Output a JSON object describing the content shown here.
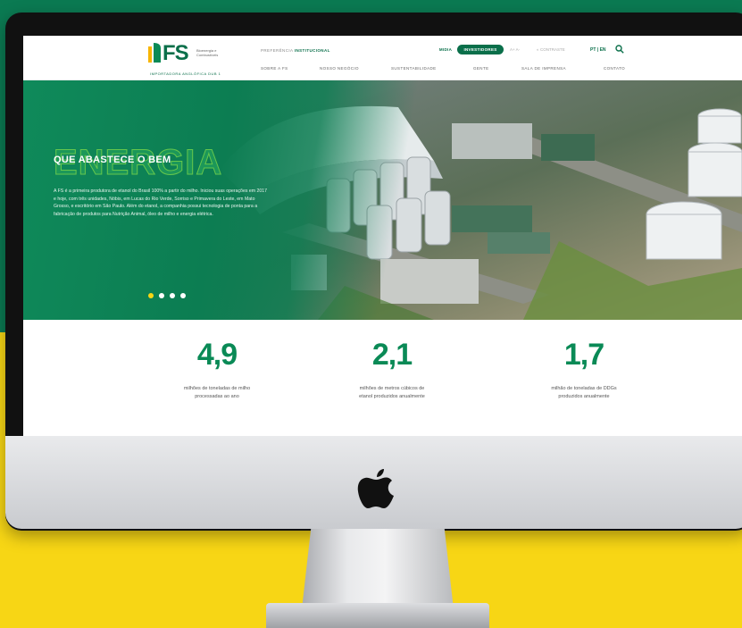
{
  "brand": {
    "logo_text": "FS",
    "logo_sub": "Bioenergia e Combustíveis",
    "logo_tag": "IMPORTADORA ANGLÓFICA DUB 1",
    "green": "#0a6f4a",
    "yellow": "#f7d615"
  },
  "topbar": {
    "left_text": "PREFERÊNCIA ",
    "left_bold": "INSTITUCIONAL",
    "midia_label": "MIDIA",
    "investidores_label": "INVESTIDORES",
    "font_controls": "A+  A-",
    "contrast_label": "◐ CONTRASTE",
    "lang_label": "PT | EN",
    "search_icon": "search-icon"
  },
  "nav": {
    "items": [
      {
        "label": "SOBRE A FS"
      },
      {
        "label": "NOSSO NEGÓCIO"
      },
      {
        "label": "SUSTENTABILIDADE"
      },
      {
        "label": "GENTE"
      },
      {
        "label": "SALA DE IMPRENSA"
      },
      {
        "label": "CONTATO"
      }
    ]
  },
  "hero": {
    "big_word": "ENERGIA",
    "title": "QUE ABASTECE O BEM",
    "text": "A FS é a primeira produtora de etanol do Brasil 100% a partir do milho. Iniciou suas operações em 2017 e hoje, com três unidades, Nóbis, em Lucas do Rio Verde, Sorriso e Primavera do Leste, em Mato Grosso, e escritório em São Paulo. Além do etanol, a companhia possui tecnologia de ponta para a fabricação de produtos para Nutrição Animal, óleo de milho e energia elétrica.",
    "slides_total": 4,
    "slide_active": 1
  },
  "stats": [
    {
      "value": "4,9",
      "label": "milhões de toneladas de milho processadas ao ano"
    },
    {
      "value": "2,1",
      "label": "milhões de metros cúbicos de etanol produzidos anualmente"
    },
    {
      "value": "1,7",
      "label": "milhão de toneladas de DDGs produzidos anualmente"
    }
  ]
}
